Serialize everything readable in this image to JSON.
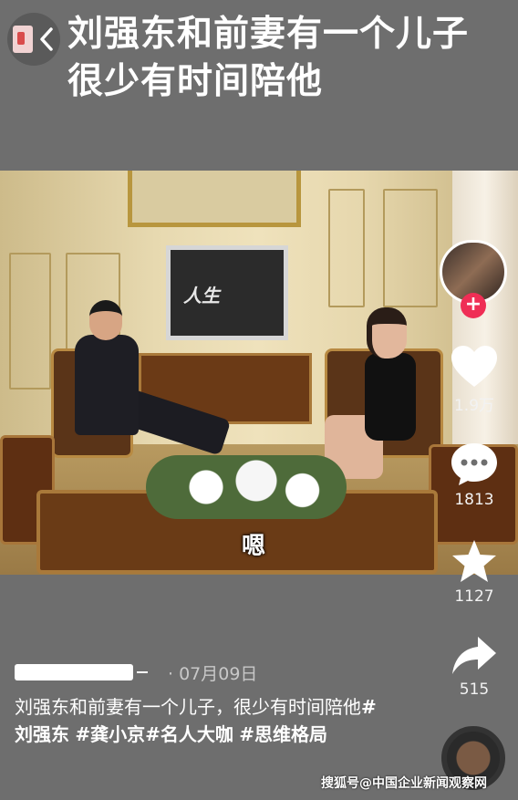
{
  "header": {
    "title": "刘强东和前妻有一个儿子 很少有时间陪他"
  },
  "video": {
    "subtitle": "嗯",
    "tv_screen_text": "人生"
  },
  "actions": {
    "likes": "1.9万",
    "comments": "1813",
    "favorites": "1127",
    "shares": "515",
    "follow_symbol": "+"
  },
  "post": {
    "date": "· 07月09日",
    "caption_text": "刘强东和前妻有一个儿子，很少有时间陪他",
    "hashtags": [
      "#刘强东",
      "#龚小京",
      "#名人大咖",
      "#思维格局"
    ]
  },
  "watermark": "搜狐号@中国企业新闻观察网",
  "colors": {
    "background": "#6e6e6e",
    "follow_badge": "#ef2e55"
  }
}
